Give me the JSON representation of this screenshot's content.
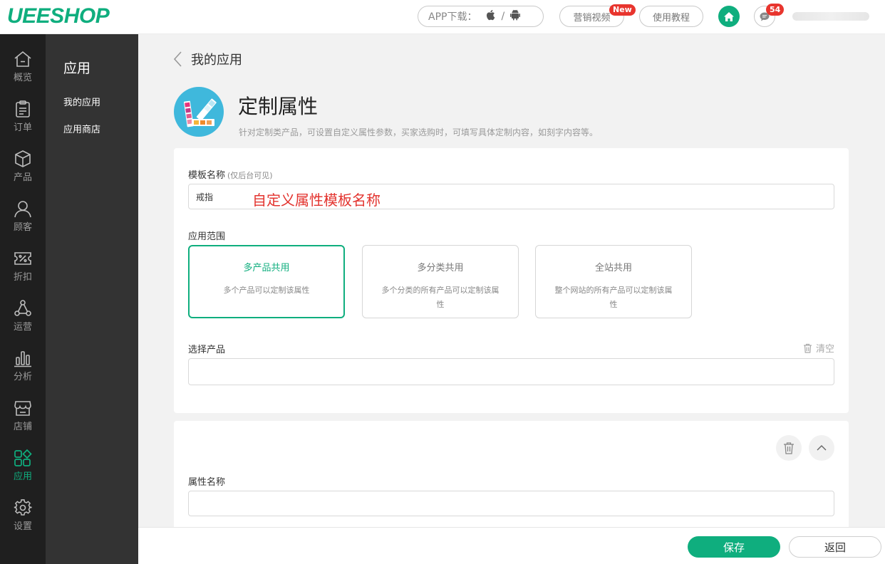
{
  "brand": {
    "logo_text": "UEESHOP",
    "accent": "#0fae7e"
  },
  "header": {
    "app_download_label": "APP下载：",
    "app_download_icons": [
      "apple-icon",
      "android-icon"
    ],
    "marketing_video_label": "营销视频",
    "new_badge": "New",
    "tutorial_label": "使用教程",
    "message_count": "54"
  },
  "leftnav": {
    "items": [
      {
        "label": "概览",
        "icon": "overview-icon"
      },
      {
        "label": "订单",
        "icon": "clipboard-icon"
      },
      {
        "label": "产品",
        "icon": "box-icon"
      },
      {
        "label": "顾客",
        "icon": "user-icon"
      },
      {
        "label": "折扣",
        "icon": "discount-icon"
      },
      {
        "label": "运营",
        "icon": "network-icon"
      },
      {
        "label": "分析",
        "icon": "bar-chart-icon"
      },
      {
        "label": "店铺",
        "icon": "store-icon"
      },
      {
        "label": "应用",
        "icon": "apps-icon",
        "active": true
      },
      {
        "label": "设置",
        "icon": "gear-icon"
      }
    ]
  },
  "subnav": {
    "title": "应用",
    "items": [
      {
        "label": "我的应用"
      },
      {
        "label": "应用商店"
      }
    ]
  },
  "breadcrumb": {
    "text": "我的应用"
  },
  "app": {
    "title": "定制属性",
    "description": "针对定制类产品，可设置自定义属性参数，买家选购时，可填写具体定制内容，如刻字内容等。"
  },
  "form": {
    "template_name_label": "模板名称",
    "template_name_hint": "(仅后台可见)",
    "template_name_value": "戒指",
    "annotation": "自定义属性模板名称",
    "scope_label": "应用范围",
    "scope_options": [
      {
        "title": "多产品共用",
        "desc": "多个产品可以定制该属性",
        "selected": true
      },
      {
        "title": "多分类共用",
        "desc": "多个分类的所有产品可以定制该属性",
        "selected": false
      },
      {
        "title": "全站共用",
        "desc": "整个网站的所有产品可以定制该属性",
        "selected": false
      }
    ],
    "select_product_label": "选择产品",
    "clear_label": "清空",
    "attribute_name_label": "属性名称"
  },
  "footer": {
    "save_label": "保存",
    "return_label": "返回"
  }
}
